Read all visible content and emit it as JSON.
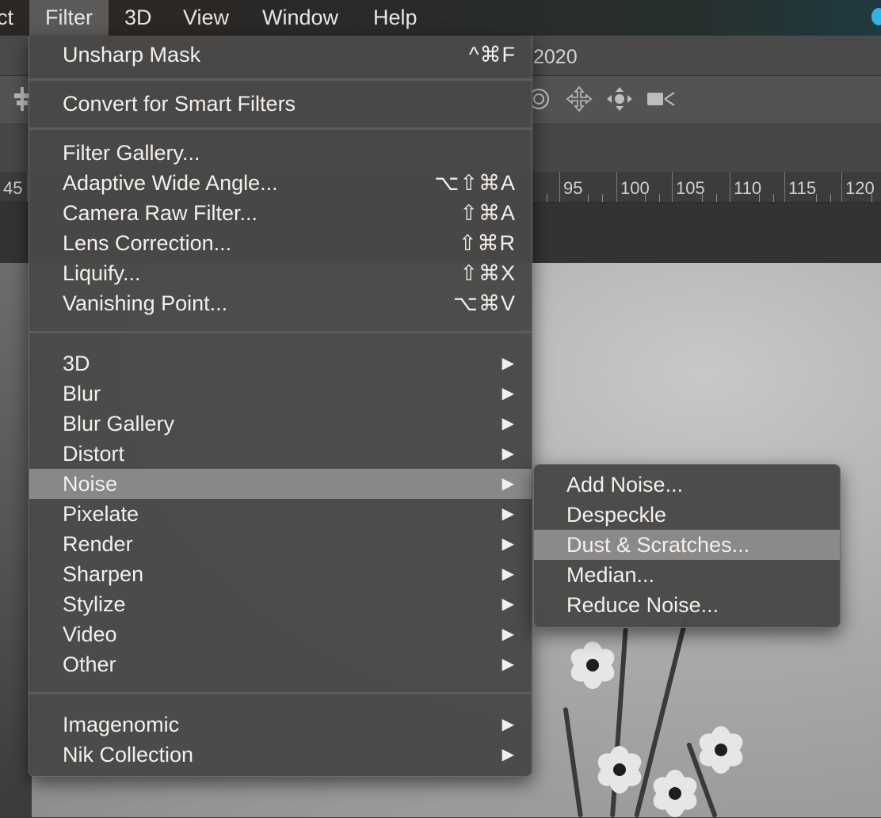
{
  "menubar": {
    "items": [
      "ct",
      "Filter",
      "3D",
      "View",
      "Window",
      "Help"
    ],
    "active": "Filter"
  },
  "document": {
    "title_fragment": "2020"
  },
  "ruler": {
    "left_label": "45",
    "labels": [
      "95",
      "100",
      "105",
      "110",
      "115",
      "120"
    ]
  },
  "filter_menu": {
    "last_filter": {
      "label": "Unsharp Mask",
      "shortcut": "^⌘F"
    },
    "smart": {
      "label": "Convert for Smart Filters"
    },
    "gallery_items": [
      {
        "label": "Filter Gallery...",
        "shortcut": ""
      },
      {
        "label": "Adaptive Wide Angle...",
        "shortcut": "⌥⇧⌘A"
      },
      {
        "label": "Camera Raw Filter...",
        "shortcut": "⇧⌘A"
      },
      {
        "label": "Lens Correction...",
        "shortcut": "⇧⌘R"
      },
      {
        "label": "Liquify...",
        "shortcut": "⇧⌘X"
      },
      {
        "label": "Vanishing Point...",
        "shortcut": "⌥⌘V"
      }
    ],
    "submenus": [
      {
        "label": "3D",
        "arrow": "▶"
      },
      {
        "label": "Blur",
        "arrow": "▶"
      },
      {
        "label": "Blur Gallery",
        "arrow": "▶"
      },
      {
        "label": "Distort",
        "arrow": "▶"
      },
      {
        "label": "Noise",
        "arrow": "▶"
      },
      {
        "label": "Pixelate",
        "arrow": "▶"
      },
      {
        "label": "Render",
        "arrow": "▶"
      },
      {
        "label": "Sharpen",
        "arrow": "▶"
      },
      {
        "label": "Stylize",
        "arrow": "▶"
      },
      {
        "label": "Video",
        "arrow": "▶"
      },
      {
        "label": "Other",
        "arrow": "▶"
      }
    ],
    "plugins": [
      {
        "label": "Imagenomic",
        "arrow": "▶"
      },
      {
        "label": "Nik Collection",
        "arrow": "▶"
      }
    ],
    "highlighted": "Noise"
  },
  "noise_submenu": {
    "items": [
      "Add Noise...",
      "Despeckle",
      "Dust & Scratches...",
      "Median...",
      "Reduce Noise..."
    ],
    "highlighted": "Dust & Scratches..."
  },
  "colors": {
    "menu_bg": "#4a4846",
    "highlight": "#8a8886",
    "accent_dot": "#2fb4e6"
  },
  "icons": [
    "align-icon",
    "target-icon",
    "move-3d-icon",
    "pan-3d-icon",
    "video-camera-icon"
  ]
}
